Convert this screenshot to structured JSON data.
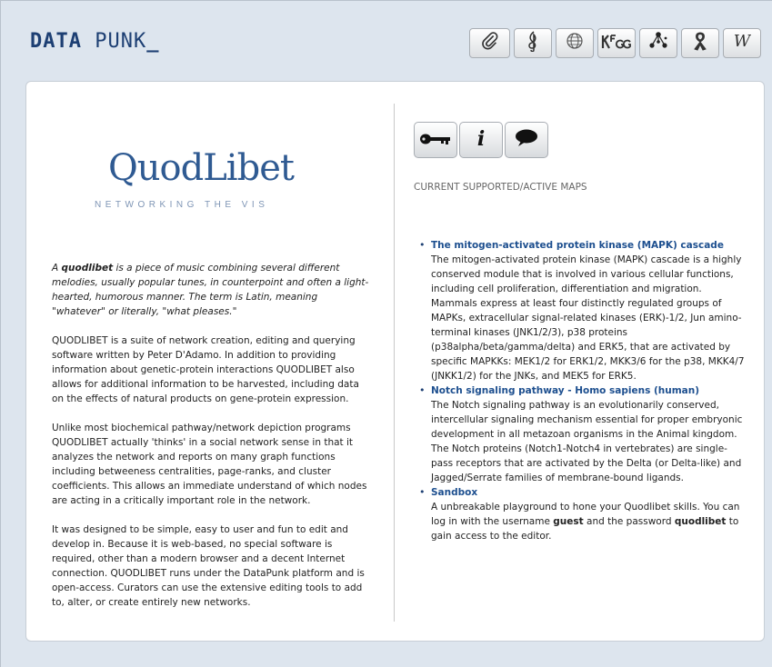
{
  "header": {
    "logo_part1": "DATA",
    "logo_part2": "PUNK",
    "logo_cursor": "_"
  },
  "toolbar": {
    "buttons": [
      {
        "icon": "paperclip-icon",
        "glyph": "🔗"
      },
      {
        "icon": "treble-clef-icon",
        "glyph": "𝄞"
      },
      {
        "icon": "globe-icon",
        "glyph": "🌐"
      },
      {
        "icon": "kegg-icon",
        "glyph": "KEGG"
      },
      {
        "icon": "network-icon",
        "glyph": "⁂"
      },
      {
        "icon": "ribbon-icon",
        "glyph": "🎗"
      },
      {
        "icon": "wikipedia-icon",
        "glyph": "W"
      }
    ]
  },
  "left": {
    "title": "QuodLibet",
    "subtitle": "NETWORKING THE VIS",
    "intro_pre": "A ",
    "intro_bold": "quodlibet",
    "intro_post": " is a piece of music combining several different melodies, usually popular tunes, in counterpoint and often a light-hearted, humorous manner. The term is Latin, meaning \"whatever\" or literally, \"what pleases.\"",
    "para1": "QUODLIBET is a suite of network creation, editing and querying software written by Peter D'Adamo. In addition to providing information about genetic-protein interactions QUODLIBET also allows for additional information to be harvested, including data on the effects of natural products on gene-protein expression.",
    "para2": "Unlike most biochemical pathway/network depiction programs QUODLIBET actually 'thinks' in a social network sense in that it analyzes the network and reports on many graph functions including betweeness centralities, page-ranks, and cluster coefficients. This allows an immediate understand of which nodes are acting in a critically important role in the network.",
    "para3": "It was designed to be simple, easy to user and fun to edit and develop in. Because it is web-based, no special software is required, other than a modern browser and a decent Internet connection. QUODLIBET runs under the DataPunk platform and is open-access. Curators can use the extensive editing tools to add to, alter, or create entirely new networks."
  },
  "right": {
    "buttons": [
      {
        "icon": "key-icon",
        "glyph": "⊸"
      },
      {
        "icon": "info-icon",
        "glyph": "i"
      },
      {
        "icon": "speech-bubble-icon",
        "glyph": "💬"
      }
    ],
    "heading": "CURRENT SUPPORTED/ACTIVE MAPS",
    "maps": [
      {
        "title": "The mitogen-activated protein kinase (MAPK) cascade",
        "description": "The mitogen-activated protein kinase (MAPK) cascade is a highly conserved module that is involved in various cellular functions, including cell proliferation, differentiation and migration. Mammals express at least four distinctly regulated groups of MAPKs, extracellular signal-related kinases (ERK)-1/2, Jun amino-terminal kinases (JNK1/2/3), p38 proteins (p38alpha/beta/gamma/delta) and ERK5, that are activated by specific MAPKKs: MEK1/2 for ERK1/2, MKK3/6 for the p38, MKK4/7 (JNKK1/2) for the JNKs, and MEK5 for ERK5."
      },
      {
        "title": "Notch signaling pathway - Homo sapiens (human)",
        "description": "The Notch signaling pathway is an evolutionarily conserved, intercellular signaling mechanism essential for proper embryonic development in all metazoan organisms in the Animal kingdom. The Notch proteins (Notch1-Notch4 in vertebrates) are single-pass receptors that are activated by the Delta (or Delta-like) and Jagged/Serrate families of membrane-bound ligands."
      },
      {
        "title": "Sandbox",
        "desc_pre": "A unbreakable playground to hone your Quodlibet skills. You can log in with the username ",
        "desc_user": "guest",
        "desc_mid": " and the password ",
        "desc_pass": "quodlibet",
        "desc_post": " to gain access to the editor."
      }
    ]
  },
  "colors": {
    "background": "#dde5ee",
    "logo": "#1d3f73",
    "link": "#1d4f8f",
    "title": "#2f5a92"
  }
}
